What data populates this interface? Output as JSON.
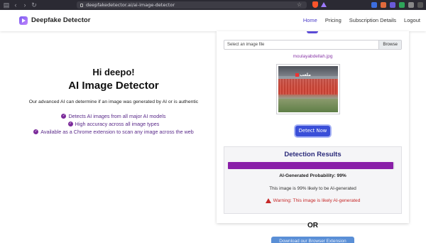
{
  "browser": {
    "url": "deepfakedetector.ai/ai-image-detector"
  },
  "header": {
    "brand": "Deepfake Detector",
    "nav": [
      {
        "label": "Home",
        "active": true
      },
      {
        "label": "Pricing",
        "active": false
      },
      {
        "label": "Subscription Details",
        "active": false
      },
      {
        "label": "Logout",
        "active": false
      }
    ]
  },
  "hero": {
    "greeting": "Hi deepo!",
    "title": "AI Image Detector",
    "description": "Our advanced AI can determine if an image was generated by AI or is authentic",
    "features": [
      "Detects AI images from all major AI models",
      "High accuracy across all image types",
      "Available as a Chrome extension to scan any image across the web"
    ]
  },
  "upload": {
    "placeholder": "Select an image file",
    "browse_label": "Browse",
    "filename": "moulayabdellah.jpg",
    "detect_label": "Detect Now"
  },
  "results": {
    "title": "Detection Results",
    "probability_label": "AI-Generated Probability: 99%",
    "probability_value": 0.99,
    "likely_text": "This image is 99% likely to be AI-generated",
    "warning_text": "Warning: This image is likely AI-generated"
  },
  "footer": {
    "or_label": "OR",
    "extension_button": "Download our Browser Extension"
  },
  "colors": {
    "accent": "#3a4fd8",
    "bar": "#8a1fa8",
    "warning": "#c62828",
    "feature_text": "#5a2a8a"
  }
}
